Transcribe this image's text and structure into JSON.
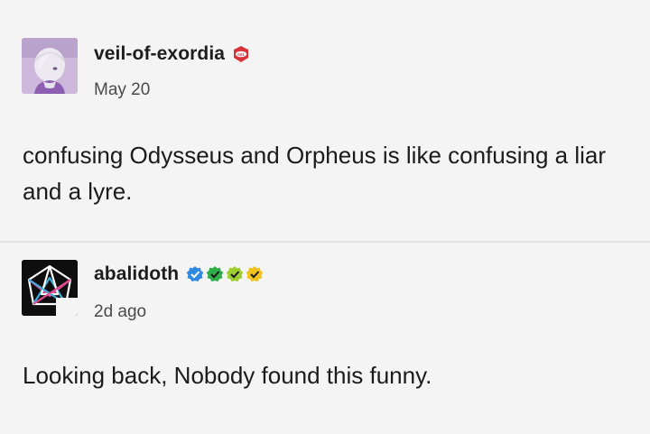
{
  "posts": [
    {
      "username": "veil-of-exordia",
      "date": "May 20",
      "body": "confusing Odysseus and Orpheus is like confusing a liar and a lyre.",
      "badges": [
        {
          "icon": "red-gem-badge-icon",
          "color": "#d8333a",
          "text": "001"
        }
      ]
    },
    {
      "username": "abalidoth",
      "date": "2d ago",
      "body": "Looking back, Nobody found this funny.",
      "badges": [
        {
          "icon": "blue-check-badge-icon",
          "color": "#2f89e0"
        },
        {
          "icon": "green-check-badge-icon",
          "color": "#2fae4a"
        },
        {
          "icon": "lime-check-badge-icon",
          "color": "#9ccf2e"
        },
        {
          "icon": "yellow-check-badge-icon",
          "color": "#f1c21b"
        }
      ]
    }
  ]
}
